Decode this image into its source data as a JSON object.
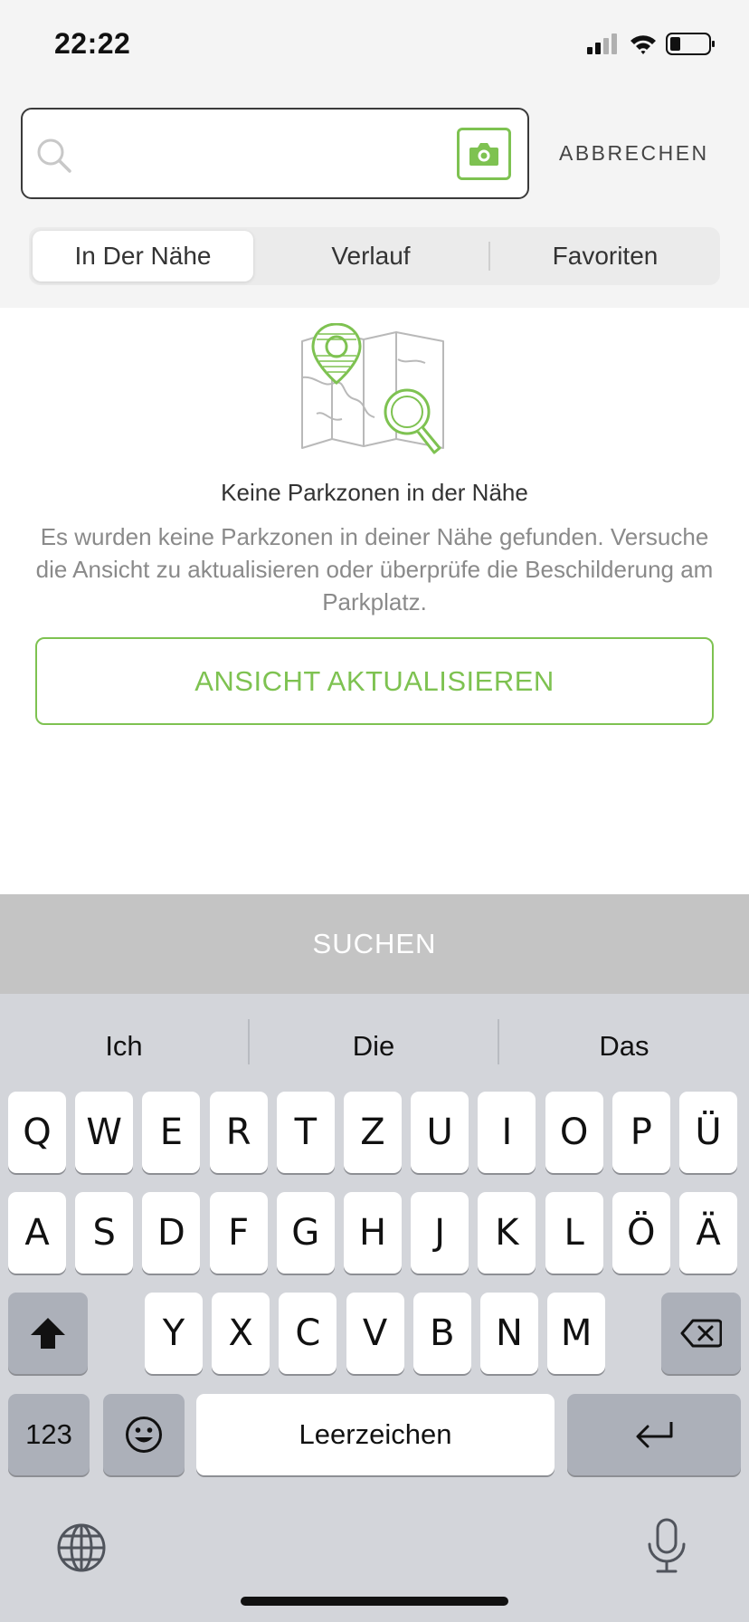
{
  "status_bar": {
    "time": "22:22"
  },
  "search": {
    "value": "",
    "cancel_label": "ABBRECHEN"
  },
  "tabs": [
    {
      "label": "In Der Nähe",
      "active": true
    },
    {
      "label": "Verlauf",
      "active": false
    },
    {
      "label": "Favoriten",
      "active": false
    }
  ],
  "empty_state": {
    "title": "Keine Parkzonen in der Nähe",
    "description": "Es wurden keine Parkzonen in deiner Nähe gefunden. Versuche die Ansicht zu aktualisieren oder überprüfe die Beschilderung am Parkplatz.",
    "refresh_label": "ANSICHT AKTUALISIEREN"
  },
  "search_button": {
    "label": "SUCHEN"
  },
  "keyboard": {
    "suggestions": [
      "Ich",
      "Die",
      "Das"
    ],
    "row1": [
      "Q",
      "W",
      "E",
      "R",
      "T",
      "Z",
      "U",
      "I",
      "O",
      "P",
      "Ü"
    ],
    "row2": [
      "A",
      "S",
      "D",
      "F",
      "G",
      "H",
      "J",
      "K",
      "L",
      "Ö",
      "Ä"
    ],
    "row3": [
      "Y",
      "X",
      "C",
      "V",
      "B",
      "N",
      "M"
    ],
    "numbers_label": "123",
    "space_label": "Leerzeichen"
  },
  "colors": {
    "accent": "#7ec251",
    "keyboard_bg": "#d3d5da",
    "search_bar_bg": "#c4c4c4"
  }
}
